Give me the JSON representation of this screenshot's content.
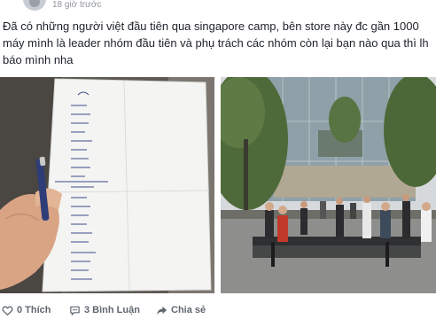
{
  "post": {
    "timestamp": "18 giờ trước",
    "text": "Đã có những người việt đầu tiên qua singapore camp, bên store này đc gần 1000 máy mình là leader nhóm đầu tiên và phụ trách các nhóm còn lại bạn nào qua thì lh báo mình nha"
  },
  "actions": {
    "like_label": "0 Thích",
    "comment_label": "3 Bình Luận",
    "share_label": "Chia sẻ"
  },
  "colors": {
    "text": "#1d2129",
    "muted": "#90949c",
    "action": "#606770"
  }
}
